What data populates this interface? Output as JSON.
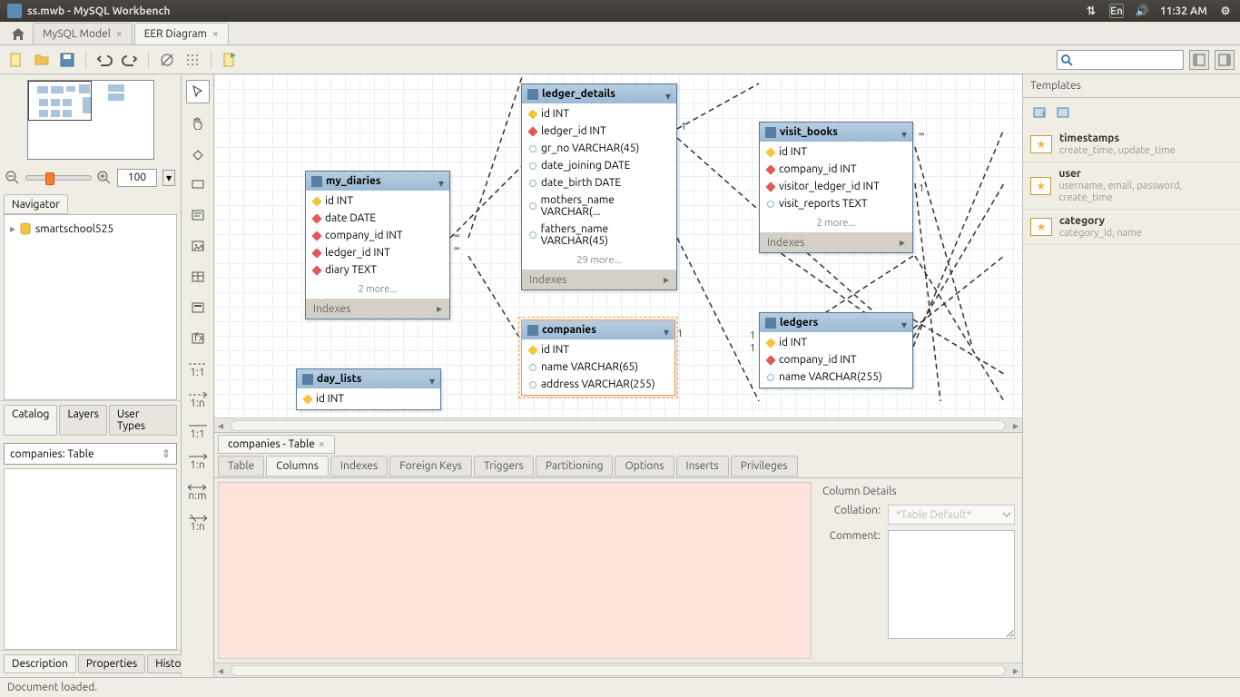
{
  "titlebar": {
    "filename": "ss.mwb",
    "appname": "MySQL Workbench",
    "lang": "En",
    "time": "11:32 AM"
  },
  "tabs": {
    "model": "MySQL Model",
    "diagram": "EER Diagram"
  },
  "navigator": {
    "label": "Navigator",
    "zoom": "100"
  },
  "schema": {
    "name": "smartschool525"
  },
  "left_tabs": {
    "catalog": "Catalog",
    "layers": "Layers",
    "usertypes": "User Types"
  },
  "obj_selector": "companies: Table",
  "insp_tabs": {
    "desc": "Description",
    "props": "Properties",
    "hist": "History"
  },
  "entities": {
    "my_diaries": {
      "name": "my_diaries",
      "cols": [
        {
          "k": "pk",
          "t": "id INT"
        },
        {
          "k": "fk",
          "t": "date DATE"
        },
        {
          "k": "fk",
          "t": "company_id INT"
        },
        {
          "k": "fk",
          "t": "ledger_id INT"
        },
        {
          "k": "fk",
          "t": "diary TEXT"
        }
      ],
      "more": "2 more...",
      "idx": "Indexes"
    },
    "ledger_details": {
      "name": "ledger_details",
      "cols": [
        {
          "k": "pk",
          "t": "id INT"
        },
        {
          "k": "fk",
          "t": "ledger_id INT"
        },
        {
          "k": "n",
          "t": "gr_no VARCHAR(45)"
        },
        {
          "k": "n",
          "t": "date_joining DATE"
        },
        {
          "k": "n",
          "t": "date_birth DATE"
        },
        {
          "k": "n",
          "t": "mothers_name VARCHAR(..."
        },
        {
          "k": "n",
          "t": "fathers_name VARCHAR(45)"
        }
      ],
      "more": "29 more...",
      "idx": "Indexes"
    },
    "visit_books": {
      "name": "visit_books",
      "cols": [
        {
          "k": "pk",
          "t": "id INT"
        },
        {
          "k": "fk",
          "t": "company_id INT"
        },
        {
          "k": "fk",
          "t": "visitor_ledger_id INT"
        },
        {
          "k": "n",
          "t": "visit_reports TEXT"
        }
      ],
      "more": "2 more...",
      "idx": "Indexes"
    },
    "day_lists": {
      "name": "day_lists",
      "cols": [
        {
          "k": "pk",
          "t": "id INT"
        }
      ]
    },
    "companies": {
      "name": "companies",
      "cols": [
        {
          "k": "pk",
          "t": "id INT"
        },
        {
          "k": "n",
          "t": "name VARCHAR(65)"
        },
        {
          "k": "n",
          "t": "address VARCHAR(255)"
        }
      ]
    },
    "ledgers": {
      "name": "ledgers",
      "cols": [
        {
          "k": "pk",
          "t": "id INT"
        },
        {
          "k": "fk",
          "t": "company_id INT"
        },
        {
          "k": "n",
          "t": "name VARCHAR(255)"
        }
      ]
    }
  },
  "cardinalities": {
    "one": "1",
    "many": "∞"
  },
  "editor": {
    "title": "companies - Table",
    "subtabs": {
      "table": "Table",
      "columns": "Columns",
      "indexes": "Indexes",
      "fk": "Foreign Keys",
      "triggers": "Triggers",
      "part": "Partitioning",
      "options": "Options",
      "inserts": "Inserts",
      "priv": "Privileges"
    },
    "details": {
      "heading": "Column Details",
      "collation": "Collation:",
      "collation_val": "*Table Default*",
      "comment": "Comment:"
    }
  },
  "templates": {
    "heading": "Templates",
    "items": [
      {
        "name": "timestamps",
        "desc": "create_time, update_time"
      },
      {
        "name": "user",
        "desc": "username, email, password, create_time"
      },
      {
        "name": "category",
        "desc": "category_id, name"
      }
    ]
  },
  "rel_labels": {
    "11": "1:1",
    "1n": "1:n",
    "nm": "n:m"
  },
  "status": "Document loaded."
}
